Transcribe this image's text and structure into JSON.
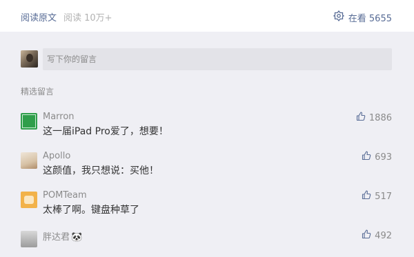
{
  "topbar": {
    "read_original": "阅读原文",
    "read_count": "阅读 10万+",
    "looking_label": "在看 5655"
  },
  "comment_input": {
    "placeholder": "写下你的留言"
  },
  "section": {
    "title": "精选留言"
  },
  "comments": [
    {
      "name": "Marron",
      "text": "这一届iPad Pro爱了，想要！",
      "likes": "1886"
    },
    {
      "name": "Apollo",
      "text": "这颜值，我只想说：买他！",
      "likes": "693"
    },
    {
      "name": "POMTeam",
      "text": "太棒了啊。键盘种草了",
      "likes": "517"
    },
    {
      "name": "胖达君",
      "emoji": "🐼",
      "text": "",
      "likes": "492"
    }
  ],
  "icons": {
    "looking": "looking-icon",
    "like": "thumbs-up-icon"
  },
  "colors": {
    "link": "#576b95",
    "bg": "#efeff4"
  }
}
